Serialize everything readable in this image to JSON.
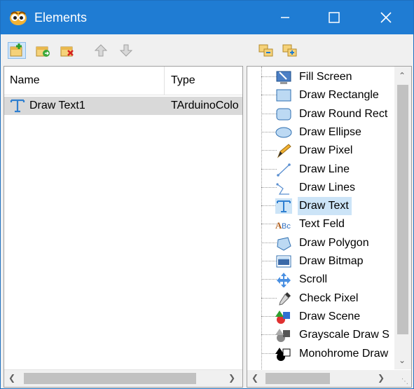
{
  "window": {
    "title": "Elements"
  },
  "icons": {
    "app": "owl-face-icon",
    "minimize": "minimize-icon",
    "maximize": "maximize-icon",
    "close": "close-icon"
  },
  "toolbar": {
    "left_buttons": [
      "add-element-icon",
      "add-folder-icon",
      "delete-element-icon",
      "move-up-icon",
      "move-down-icon"
    ],
    "right_buttons": [
      "expand-all-icon",
      "collapse-all-icon"
    ]
  },
  "left_panel": {
    "columns": [
      "Name",
      "Type"
    ],
    "rows": [
      {
        "name": "Draw Text1",
        "type": "TArduinoColo",
        "icon": "draw-text-icon",
        "selected": true
      }
    ]
  },
  "right_panel": {
    "items": [
      {
        "label": "Fill Screen",
        "icon": "fill-screen-icon"
      },
      {
        "label": "Draw Rectangle",
        "icon": "rectangle-icon"
      },
      {
        "label": "Draw Round Rect",
        "icon": "round-rectangle-icon"
      },
      {
        "label": "Draw Ellipse",
        "icon": "ellipse-icon"
      },
      {
        "label": "Draw Pixel",
        "icon": "pencil-icon"
      },
      {
        "label": "Draw Line",
        "icon": "line-icon"
      },
      {
        "label": "Draw Lines",
        "icon": "polyline-icon"
      },
      {
        "label": "Draw Text",
        "icon": "draw-text-icon",
        "selected": true
      },
      {
        "label": "Text Feld",
        "icon": "text-field-icon"
      },
      {
        "label": "Draw Polygon",
        "icon": "polygon-icon"
      },
      {
        "label": "Draw Bitmap",
        "icon": "bitmap-icon"
      },
      {
        "label": "Scroll",
        "icon": "move-arrows-icon"
      },
      {
        "label": "Check Pixel",
        "icon": "eyedropper-icon"
      },
      {
        "label": "Draw Scene",
        "icon": "scene-shapes-icon"
      },
      {
        "label": "Grayscale Draw S",
        "icon": "grayscale-scene-icon"
      },
      {
        "label": "Monohrome Draw",
        "icon": "monochrome-scene-icon"
      }
    ]
  },
  "colors": {
    "titlebar": "#1f7cd3",
    "selection": "#cce4f7",
    "row_selected": "#d9d9d9"
  }
}
